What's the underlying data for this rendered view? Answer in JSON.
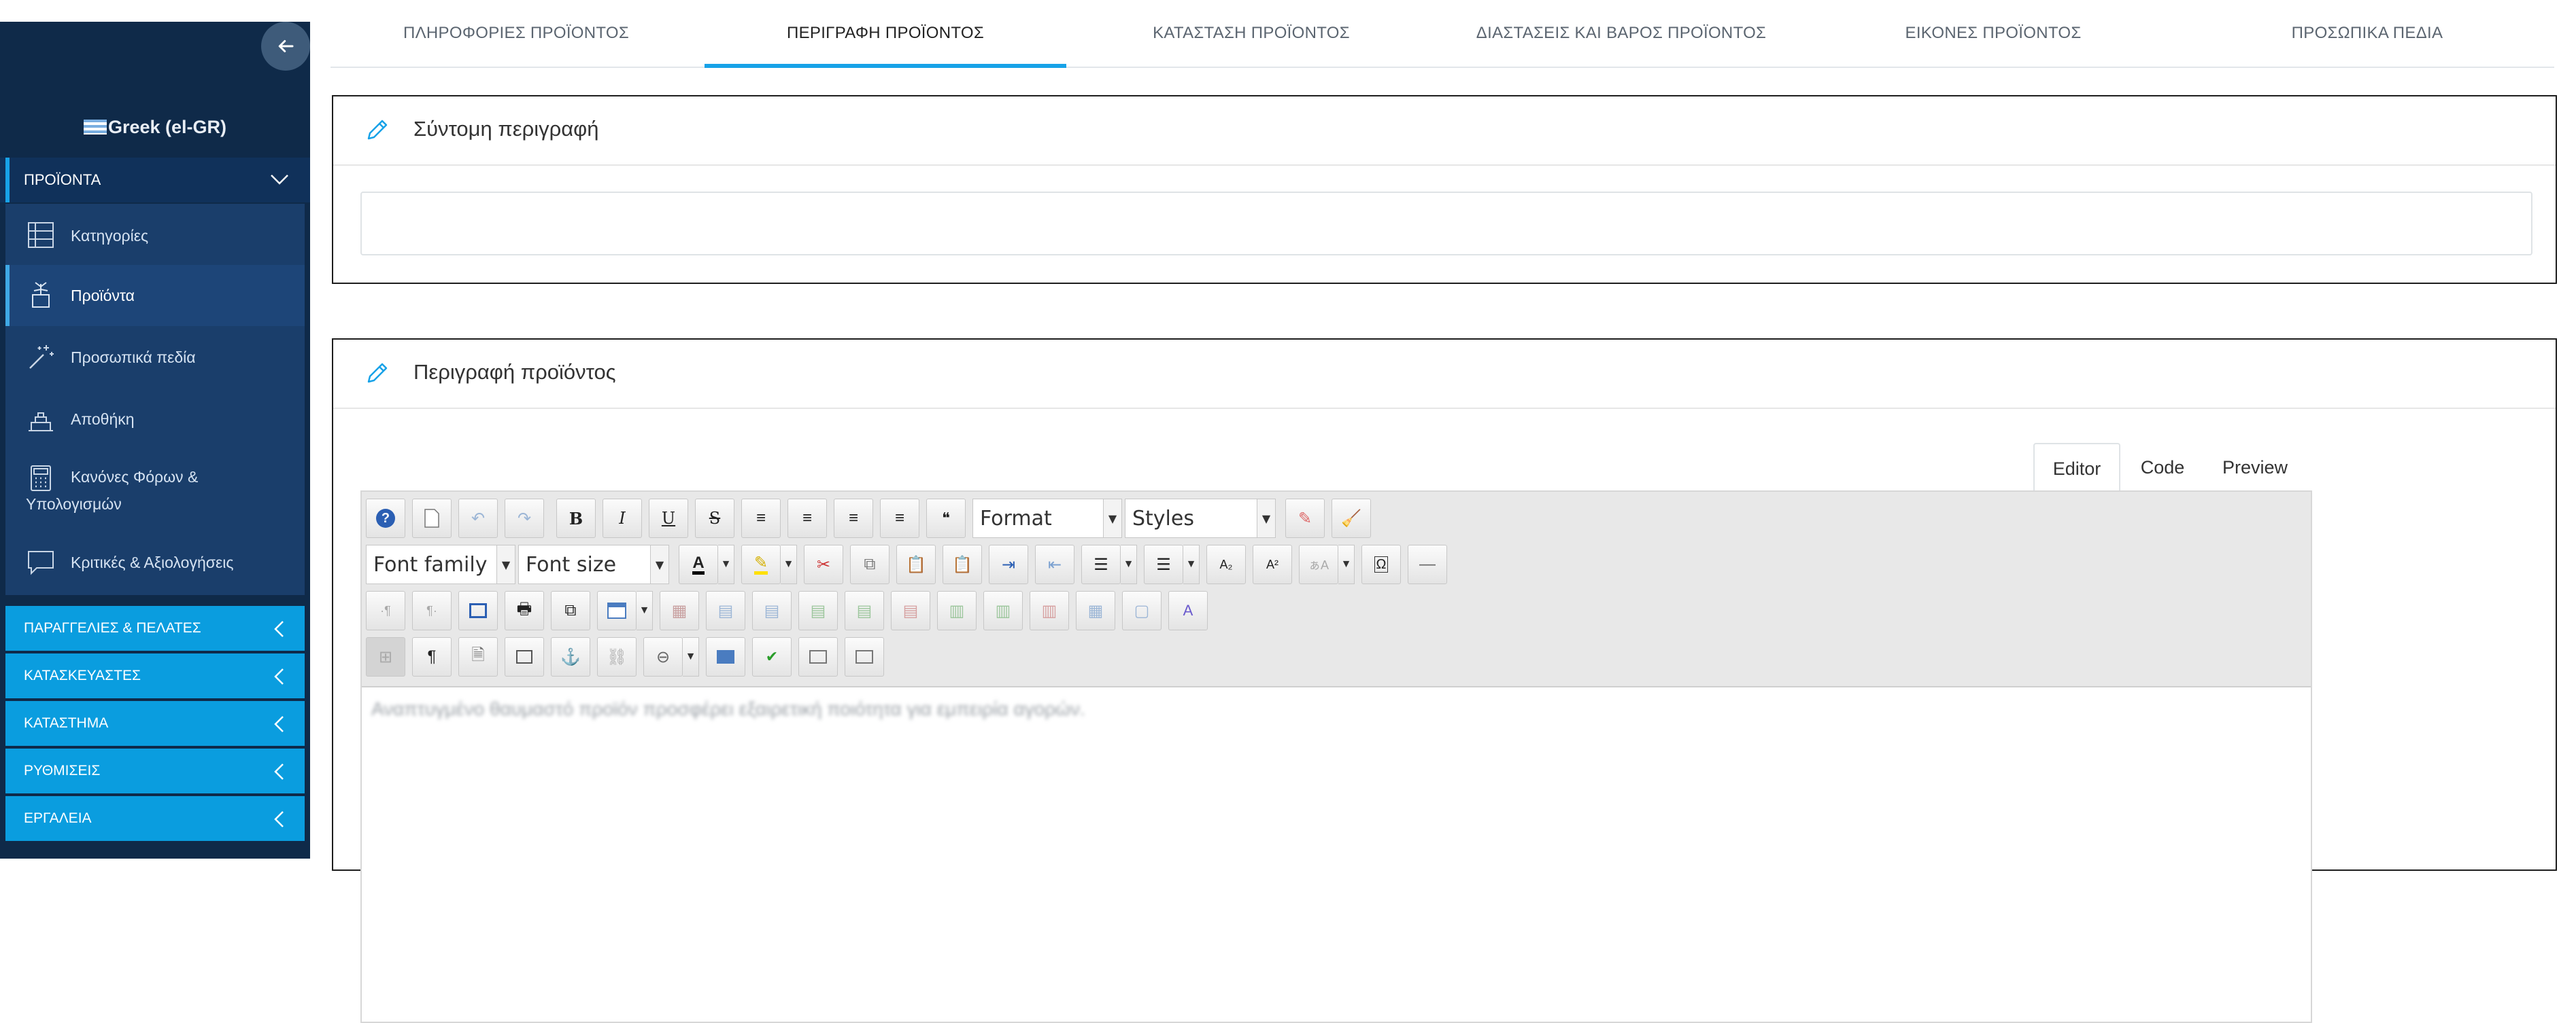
{
  "sidebar": {
    "language": "Greek (el-GR)",
    "open_section": "ΠΡΟΪΟΝΤΑ",
    "items": [
      {
        "label": "Κατηγορίες",
        "icon": "categories-icon"
      },
      {
        "label": "Προϊόντα",
        "icon": "products-icon",
        "active": true
      },
      {
        "label": "Προσωπικά πεδία",
        "icon": "custom-fields-icon"
      },
      {
        "label": "Αποθήκη",
        "icon": "warehouse-icon"
      },
      {
        "label_line1": "Κανόνες Φόρων &",
        "label_line2": "Υπολογισμών",
        "icon": "calculator-icon"
      },
      {
        "label": "Κριτικές & Αξιολογήσεις",
        "icon": "reviews-icon"
      }
    ],
    "sections": [
      {
        "label": "ΠΑΡΑΓΓΕΛΙΕΣ & ΠΕΛΑΤΕΣ"
      },
      {
        "label": "ΚΑΤΑΣΚΕΥΑΣΤΕΣ"
      },
      {
        "label": "ΚΑΤΑΣΤΗΜΑ"
      },
      {
        "label": "ΡΥΘΜΙΣΕΙΣ"
      },
      {
        "label": "ΕΡΓΑΛΕΙΑ"
      }
    ]
  },
  "tabs": [
    {
      "label": "ΠΛΗΡΟΦΟΡΙΕΣ ΠΡΟΪΟΝΤΟΣ"
    },
    {
      "label": "ΠΕΡΙΓΡΑΦΗ ΠΡΟΪΟΝΤΟΣ",
      "active": true
    },
    {
      "label": "ΚΑΤΑΣΤΑΣΗ ΠΡΟΪΟΝΤΟΣ"
    },
    {
      "label": "ΔΙΑΣΤΑΣΕΙΣ ΚΑΙ ΒΑΡΟΣ ΠΡΟΪΟΝΤΟΣ"
    },
    {
      "label": "ΕΙΚΟΝΕΣ ΠΡΟΪΟΝΤΟΣ"
    },
    {
      "label": "ΠΡΟΣΩΠΙΚΑ ΠΕΔΙΑ"
    }
  ],
  "short_description": {
    "title": "Σύντομη περιγραφή",
    "value": ""
  },
  "description": {
    "title": "Περιγραφή προϊόντος",
    "editor_tabs": [
      {
        "label": "Editor",
        "active": true
      },
      {
        "label": "Code"
      },
      {
        "label": "Preview"
      }
    ],
    "toolbar": {
      "format": "Format",
      "styles": "Styles",
      "font_family": "Font family",
      "font_size": "Font size"
    },
    "content": "Αναπτυγμένο θαυμαστό προϊόν προσφέρει εξαιρετική ποιότητα για εμπειρία αγορών."
  },
  "colors": {
    "accent": "#17a2e8",
    "sidebar_bg": "#0f2a49",
    "section_bg": "#0a9ddf"
  }
}
